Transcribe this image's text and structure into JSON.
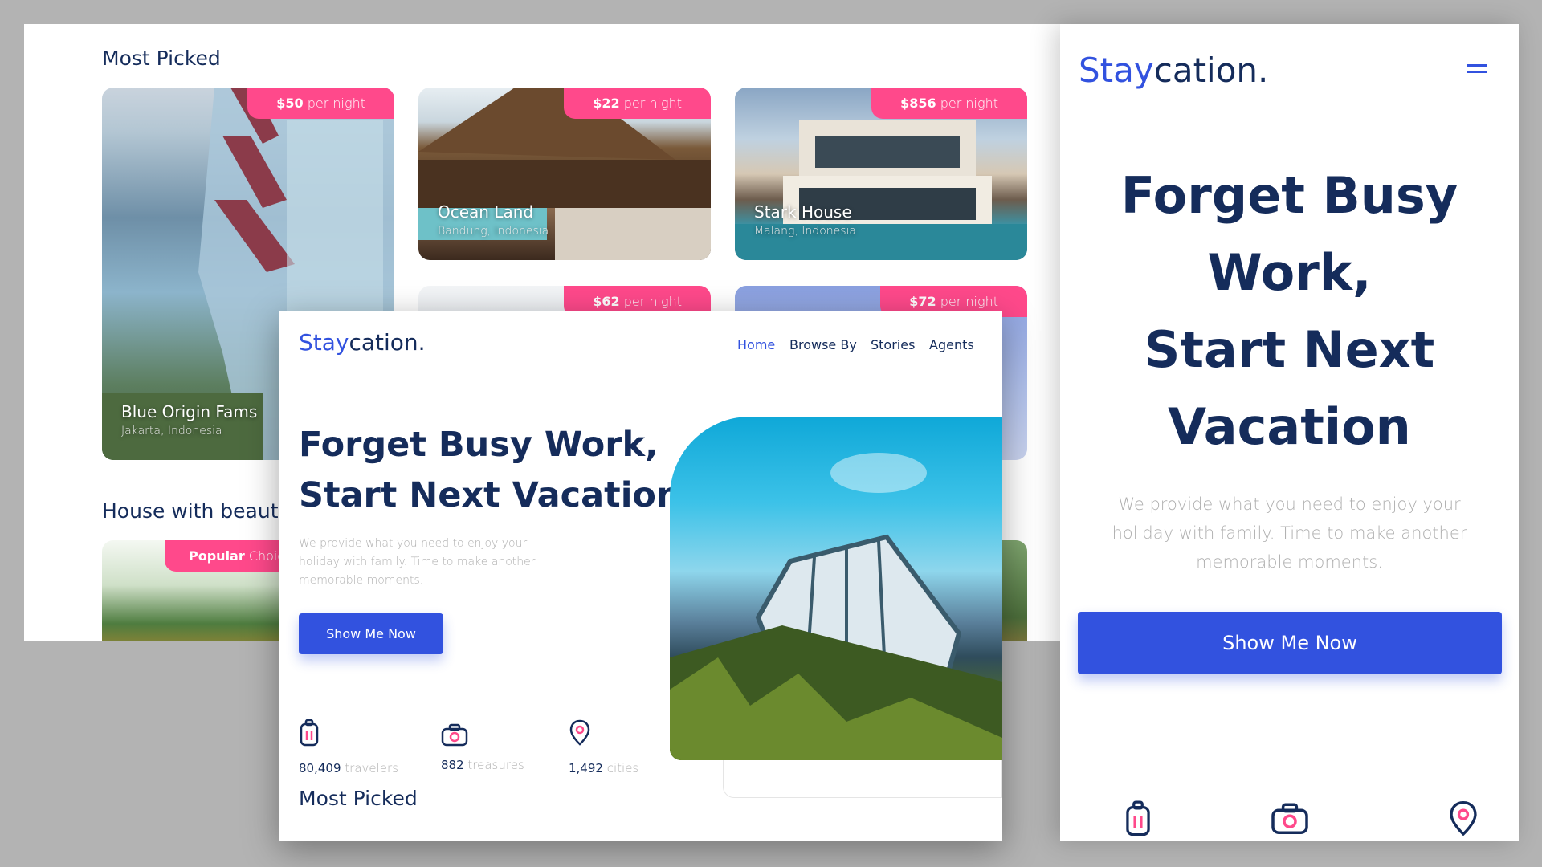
{
  "colors": {
    "primary": "#3252df",
    "navy": "#152c5b",
    "pink": "#ff498b",
    "muted": "#b0b0b0"
  },
  "desktop_back": {
    "most_picked_title": "Most Picked",
    "cards": [
      {
        "price": "$50",
        "unit": "per night",
        "name": "Blue Origin Fams",
        "location": "Jakarta, Indonesia"
      },
      {
        "price": "$22",
        "unit": "per night",
        "name": "Ocean Land",
        "location": "Bandung, Indonesia"
      },
      {
        "price": "$856",
        "unit": "per night",
        "name": "Stark House",
        "location": "Malang, Indonesia"
      },
      {
        "price": "$62",
        "unit": "per night"
      },
      {
        "price": "$72",
        "unit": "per night"
      }
    ],
    "house_section_title": "House with beauty",
    "popular_tag": {
      "bold": "Popular",
      "light": "Choice"
    }
  },
  "desktop_front": {
    "logo": {
      "highlight": "Stay",
      "rest": "cation."
    },
    "nav": [
      "Home",
      "Browse By",
      "Stories",
      "Agents"
    ],
    "hero": {
      "title_line1": "Forget Busy Work,",
      "title_line2": "Start Next Vacation",
      "subtitle_line1": "We provide what you need to enjoy your",
      "subtitle_line2": "holiday with family. Time to make another",
      "subtitle_line3": "memorable moments.",
      "button": "Show Me Now"
    },
    "stats": [
      {
        "icon": "luggage-icon",
        "number": "80,409",
        "unit": "travelers"
      },
      {
        "icon": "camera-icon",
        "number": "882",
        "unit": "treasures"
      },
      {
        "icon": "location-pin-icon",
        "number": "1,492",
        "unit": "cities"
      }
    ],
    "most_picked_title": "Most Picked"
  },
  "mobile": {
    "logo": {
      "highlight": "Stay",
      "rest": "cation."
    },
    "hero": {
      "title_line1": "Forget Busy",
      "title_line2": "Work,",
      "title_line3": "Start Next",
      "title_line4": "Vacation",
      "subtitle_line1": "We provide what you need to enjoy your",
      "subtitle_line2": "holiday with family. Time to make another",
      "subtitle_line3": "memorable moments.",
      "button": "Show Me Now"
    },
    "icons": [
      "luggage-icon",
      "camera-icon",
      "location-pin-icon"
    ]
  }
}
